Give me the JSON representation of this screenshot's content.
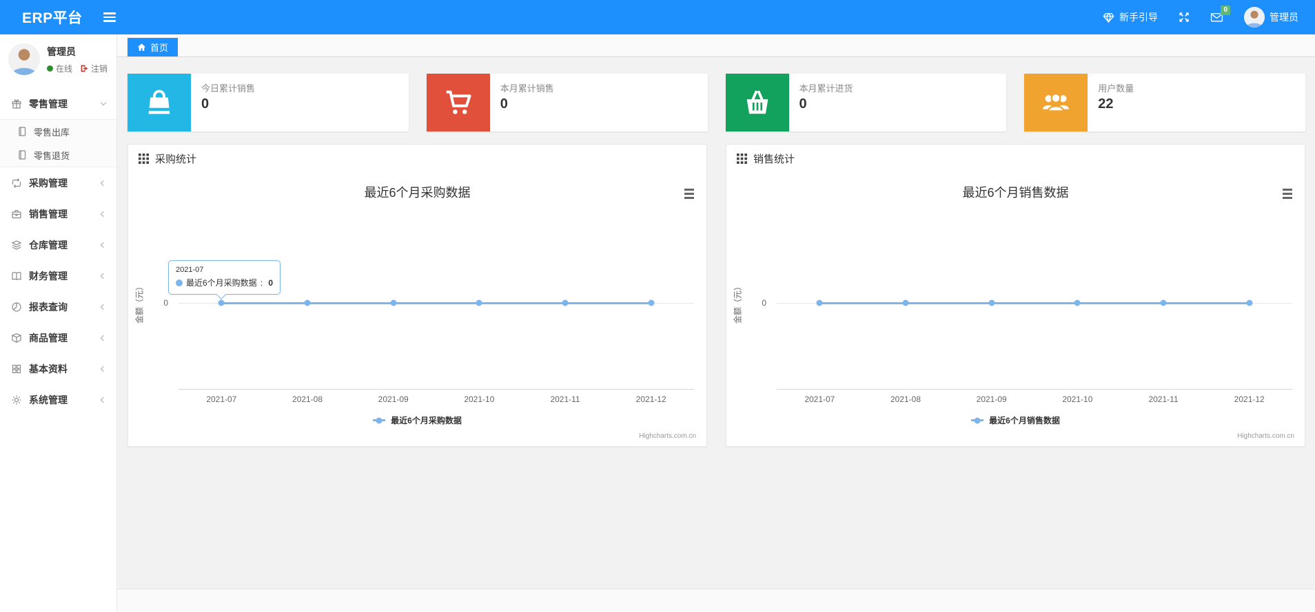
{
  "navbar": {
    "brand": "ERP平台",
    "guide_label": "新手引导",
    "message_badge": "0",
    "user_name": "管理员"
  },
  "sidebar": {
    "user": {
      "name": "管理员",
      "status_online": "在线",
      "logout_label": "注销"
    },
    "menu": [
      {
        "label": "零售管理",
        "icon": "gift-icon",
        "state": "expanded",
        "children": [
          {
            "label": "零售出库"
          },
          {
            "label": "零售退货"
          }
        ]
      },
      {
        "label": "采购管理",
        "icon": "repeat-icon"
      },
      {
        "label": "销售管理",
        "icon": "briefcase-icon"
      },
      {
        "label": "仓库管理",
        "icon": "layers-icon"
      },
      {
        "label": "财务管理",
        "icon": "book-icon"
      },
      {
        "label": "报表查询",
        "icon": "pie-chart-icon"
      },
      {
        "label": "商品管理",
        "icon": "box-icon"
      },
      {
        "label": "基本资料",
        "icon": "grid-icon"
      },
      {
        "label": "系统管理",
        "icon": "gear-icon"
      }
    ]
  },
  "tabs": {
    "home_label": "首页"
  },
  "stat_cards": [
    {
      "label": "今日累计销售",
      "value": "0",
      "color": "#23b7e5",
      "icon": "shopping-bag-icon"
    },
    {
      "label": "本月累计销售",
      "value": "0",
      "color": "#e0503b",
      "icon": "shopping-cart-icon"
    },
    {
      "label": "本月累计进货",
      "value": "0",
      "color": "#12a25e",
      "icon": "shopping-basket-icon"
    },
    {
      "label": "用户数量",
      "value": "22",
      "color": "#f0a32f",
      "icon": "users-icon"
    }
  ],
  "chart_data": [
    {
      "type": "line",
      "panel_title": "采购统计",
      "title": "最近6个月采购数据",
      "categories": [
        "2021-07",
        "2021-08",
        "2021-09",
        "2021-10",
        "2021-11",
        "2021-12"
      ],
      "series": [
        {
          "name": "最近6个月采购数据",
          "values": [
            0,
            0,
            0,
            0,
            0,
            0
          ],
          "color": "#7cb5ec"
        }
      ],
      "xlabel": "",
      "ylabel": "金额（元）",
      "ytick_labels": [
        "0"
      ],
      "ylim": [
        0,
        0
      ],
      "legend_position": "bottom",
      "grid": "off",
      "credit": "Highcharts.com.cn",
      "tooltip": {
        "header": "2021-07",
        "series_label": "最近6个月采购数据",
        "separator": ": ",
        "value": "0"
      }
    },
    {
      "type": "line",
      "panel_title": "销售统计",
      "title": "最近6个月销售数据",
      "categories": [
        "2021-07",
        "2021-08",
        "2021-09",
        "2021-10",
        "2021-11",
        "2021-12"
      ],
      "series": [
        {
          "name": "最近6个月销售数据",
          "values": [
            0,
            0,
            0,
            0,
            0,
            0
          ],
          "color": "#7cb5ec"
        }
      ],
      "xlabel": "",
      "ylabel": "金额（元）",
      "ytick_labels": [
        "0"
      ],
      "ylim": [
        0,
        0
      ],
      "legend_position": "bottom",
      "grid": "off",
      "credit": "Highcharts.com.cn"
    }
  ]
}
